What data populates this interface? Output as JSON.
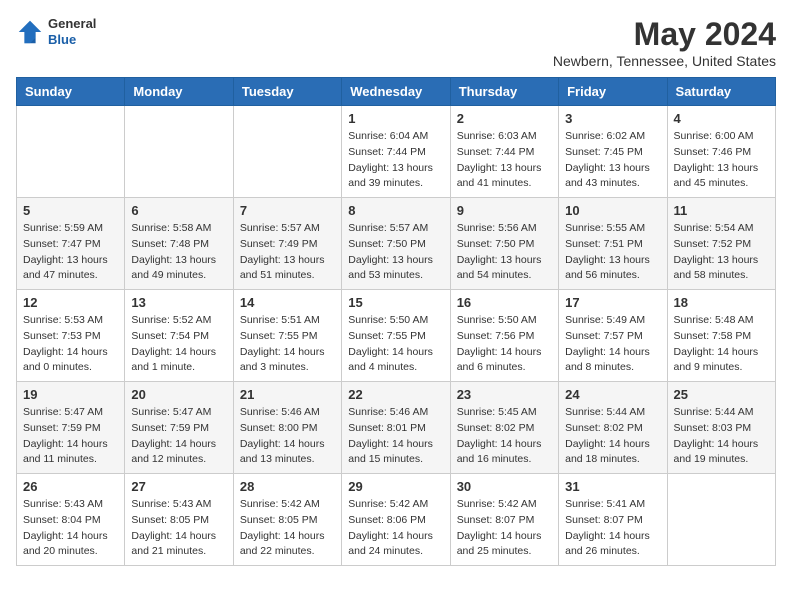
{
  "header": {
    "logo": {
      "general": "General",
      "blue": "Blue"
    },
    "title": "May 2024",
    "location": "Newbern, Tennessee, United States"
  },
  "days_of_week": [
    "Sunday",
    "Monday",
    "Tuesday",
    "Wednesday",
    "Thursday",
    "Friday",
    "Saturday"
  ],
  "weeks": [
    [
      null,
      null,
      null,
      {
        "day": "1",
        "sunrise": "6:04 AM",
        "sunset": "7:44 PM",
        "daylight": "13 hours and 39 minutes."
      },
      {
        "day": "2",
        "sunrise": "6:03 AM",
        "sunset": "7:44 PM",
        "daylight": "13 hours and 41 minutes."
      },
      {
        "day": "3",
        "sunrise": "6:02 AM",
        "sunset": "7:45 PM",
        "daylight": "13 hours and 43 minutes."
      },
      {
        "day": "4",
        "sunrise": "6:00 AM",
        "sunset": "7:46 PM",
        "daylight": "13 hours and 45 minutes."
      }
    ],
    [
      {
        "day": "5",
        "sunrise": "5:59 AM",
        "sunset": "7:47 PM",
        "daylight": "13 hours and 47 minutes."
      },
      {
        "day": "6",
        "sunrise": "5:58 AM",
        "sunset": "7:48 PM",
        "daylight": "13 hours and 49 minutes."
      },
      {
        "day": "7",
        "sunrise": "5:57 AM",
        "sunset": "7:49 PM",
        "daylight": "13 hours and 51 minutes."
      },
      {
        "day": "8",
        "sunrise": "5:57 AM",
        "sunset": "7:50 PM",
        "daylight": "13 hours and 53 minutes."
      },
      {
        "day": "9",
        "sunrise": "5:56 AM",
        "sunset": "7:50 PM",
        "daylight": "13 hours and 54 minutes."
      },
      {
        "day": "10",
        "sunrise": "5:55 AM",
        "sunset": "7:51 PM",
        "daylight": "13 hours and 56 minutes."
      },
      {
        "day": "11",
        "sunrise": "5:54 AM",
        "sunset": "7:52 PM",
        "daylight": "13 hours and 58 minutes."
      }
    ],
    [
      {
        "day": "12",
        "sunrise": "5:53 AM",
        "sunset": "7:53 PM",
        "daylight": "14 hours and 0 minutes."
      },
      {
        "day": "13",
        "sunrise": "5:52 AM",
        "sunset": "7:54 PM",
        "daylight": "14 hours and 1 minute."
      },
      {
        "day": "14",
        "sunrise": "5:51 AM",
        "sunset": "7:55 PM",
        "daylight": "14 hours and 3 minutes."
      },
      {
        "day": "15",
        "sunrise": "5:50 AM",
        "sunset": "7:55 PM",
        "daylight": "14 hours and 4 minutes."
      },
      {
        "day": "16",
        "sunrise": "5:50 AM",
        "sunset": "7:56 PM",
        "daylight": "14 hours and 6 minutes."
      },
      {
        "day": "17",
        "sunrise": "5:49 AM",
        "sunset": "7:57 PM",
        "daylight": "14 hours and 8 minutes."
      },
      {
        "day": "18",
        "sunrise": "5:48 AM",
        "sunset": "7:58 PM",
        "daylight": "14 hours and 9 minutes."
      }
    ],
    [
      {
        "day": "19",
        "sunrise": "5:47 AM",
        "sunset": "7:59 PM",
        "daylight": "14 hours and 11 minutes."
      },
      {
        "day": "20",
        "sunrise": "5:47 AM",
        "sunset": "7:59 PM",
        "daylight": "14 hours and 12 minutes."
      },
      {
        "day": "21",
        "sunrise": "5:46 AM",
        "sunset": "8:00 PM",
        "daylight": "14 hours and 13 minutes."
      },
      {
        "day": "22",
        "sunrise": "5:46 AM",
        "sunset": "8:01 PM",
        "daylight": "14 hours and 15 minutes."
      },
      {
        "day": "23",
        "sunrise": "5:45 AM",
        "sunset": "8:02 PM",
        "daylight": "14 hours and 16 minutes."
      },
      {
        "day": "24",
        "sunrise": "5:44 AM",
        "sunset": "8:02 PM",
        "daylight": "14 hours and 18 minutes."
      },
      {
        "day": "25",
        "sunrise": "5:44 AM",
        "sunset": "8:03 PM",
        "daylight": "14 hours and 19 minutes."
      }
    ],
    [
      {
        "day": "26",
        "sunrise": "5:43 AM",
        "sunset": "8:04 PM",
        "daylight": "14 hours and 20 minutes."
      },
      {
        "day": "27",
        "sunrise": "5:43 AM",
        "sunset": "8:05 PM",
        "daylight": "14 hours and 21 minutes."
      },
      {
        "day": "28",
        "sunrise": "5:42 AM",
        "sunset": "8:05 PM",
        "daylight": "14 hours and 22 minutes."
      },
      {
        "day": "29",
        "sunrise": "5:42 AM",
        "sunset": "8:06 PM",
        "daylight": "14 hours and 24 minutes."
      },
      {
        "day": "30",
        "sunrise": "5:42 AM",
        "sunset": "8:07 PM",
        "daylight": "14 hours and 25 minutes."
      },
      {
        "day": "31",
        "sunrise": "5:41 AM",
        "sunset": "8:07 PM",
        "daylight": "14 hours and 26 minutes."
      },
      null
    ]
  ]
}
